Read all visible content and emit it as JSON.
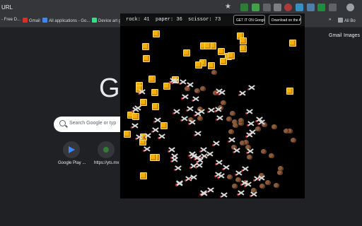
{
  "browser": {
    "url_text": "URL",
    "bookmarks": [
      "- Free D...",
      "Gmail",
      "All applications - Go...",
      "Device art g"
    ],
    "all_bookmarks": "All Bo"
  },
  "google": {
    "nav_links": [
      "Gmail",
      "Images"
    ],
    "logo_letter": "G",
    "search_placeholder": "Search Google or typ",
    "shortcuts": [
      "Google Play ...",
      "https://yts.mx"
    ]
  },
  "game": {
    "rock_label": "rock: 41",
    "paper_label": "paper: 36",
    "scissor_label": "scissor: 73",
    "google_play": "GET IT ON Google Play",
    "app_store": "Download on the App Store",
    "counts": {
      "rock": 41,
      "paper": 36,
      "scissor": 73
    }
  }
}
